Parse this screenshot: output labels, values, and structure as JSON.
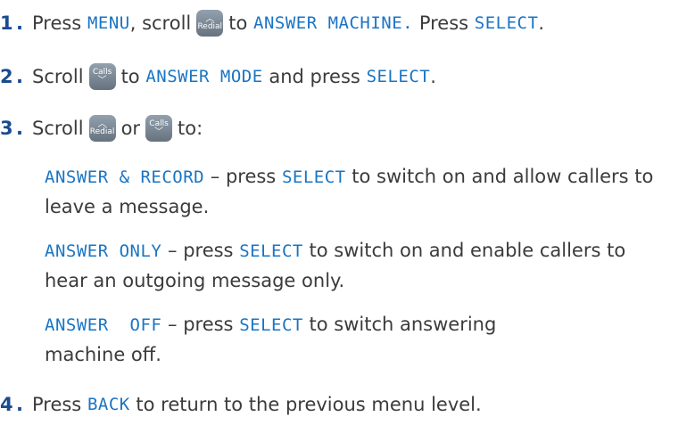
{
  "steps": {
    "s1": {
      "num": "1",
      "dot": ".",
      "t1": "Press",
      "lcd1": "MENU",
      "t2": ", scroll",
      "key": {
        "label": "Redial",
        "icon": "up-chevron-icon"
      },
      "t3": "to",
      "lcd2": "ANSWER MACHINE.",
      "t4": "Press",
      "lcd3": "SELECT",
      "t5": "."
    },
    "s2": {
      "num": "2",
      "dot": ".",
      "t1": "Scroll",
      "key": {
        "label": "Calls",
        "icon": "down-chevron-icon"
      },
      "t2": "to",
      "lcd1": "ANSWER MODE",
      "t3": "and press",
      "lcd2": "SELECT",
      "t4": "."
    },
    "s3": {
      "num": "3",
      "dot": ".",
      "t1": "Scroll",
      "key1": {
        "label": "Redial",
        "icon": "up-chevron-icon"
      },
      "t2": "or",
      "key2": {
        "label": "Calls",
        "icon": "down-chevron-icon"
      },
      "t3": "to:"
    },
    "options": [
      {
        "lcd1": "ANSWER & RECORD",
        "t1": " – press ",
        "lcd2": "SELECT",
        "t2": " to switch on and allow callers to leave a message."
      },
      {
        "lcd1": "ANSWER ONLY",
        "t1": " – press ",
        "lcd2": "SELECT",
        "t2": " to switch on and enable callers to hear an outgoing message only."
      },
      {
        "lcd1": "ANSWER  OFF",
        "t1": " – press ",
        "lcd2": "SELECT",
        "t2": " to switch answering machine off."
      }
    ],
    "s4": {
      "num": "4",
      "dot": ".",
      "t1": "Press",
      "lcd1": "BACK",
      "t2": "to return to the previous menu level."
    }
  },
  "colors": {
    "number": "#1a4b8f",
    "lcd": "#1a74c4",
    "text": "#3b3b3b",
    "key": "#7d8a96"
  }
}
